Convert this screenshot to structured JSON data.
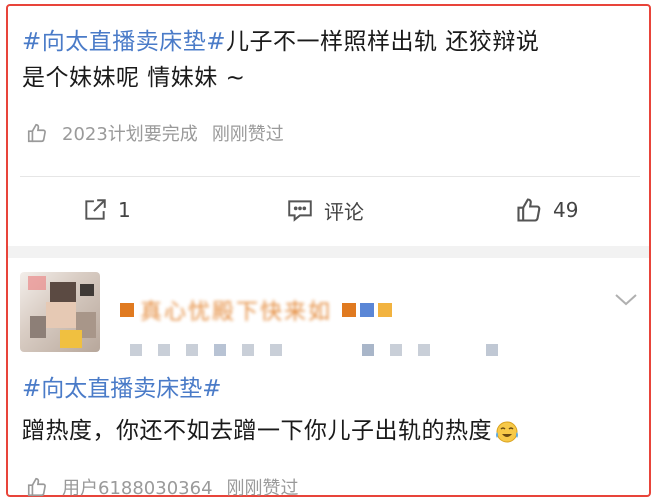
{
  "post": {
    "hashtag": "#向太直播卖床垫#",
    "text_line1": "儿子不一样照样出轨 还狡辩说",
    "text_line2": "是个妹妹呢 情妹妹 ~",
    "source": "2023计划要完成",
    "liked_by": "刚刚赞过"
  },
  "actions": {
    "share_count": "1",
    "comment_label": "评论",
    "like_count": "49"
  },
  "comment": {
    "username": "真心忧殿下快来如",
    "hashtag": "#向太直播卖床垫#",
    "text": "蹭热度，你还不如去蹭一下你儿子出轨的热度",
    "emoji": "crying-laughing-emoji",
    "source": "用户6188030364",
    "liked_by": "刚刚赞过"
  },
  "colors": {
    "hashtag": "#4a7bc8",
    "border": "#e8443a",
    "meta": "#9a9a9a"
  }
}
